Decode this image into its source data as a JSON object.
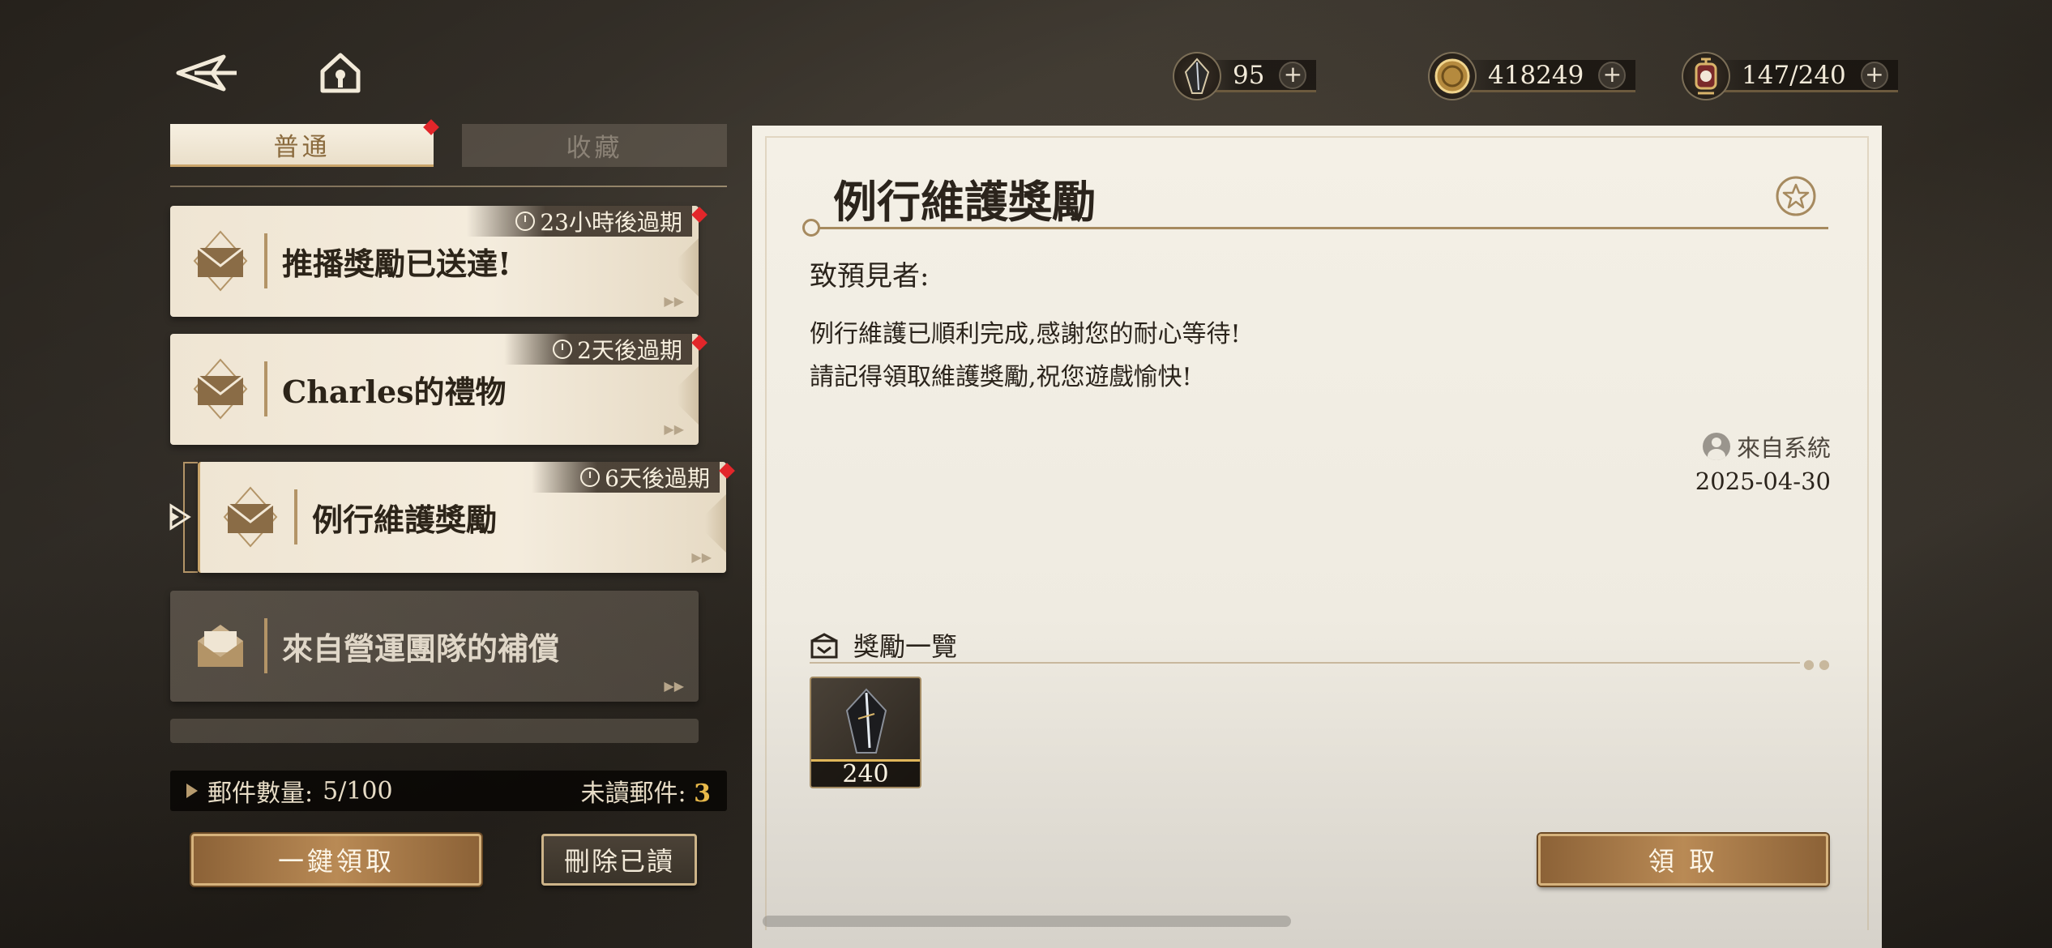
{
  "topbar": {
    "currencies": [
      {
        "icon": "quill-gem-icon",
        "value": "95"
      },
      {
        "icon": "gold-coin-icon",
        "value": "418249"
      },
      {
        "icon": "lantern-icon",
        "value": "147/240"
      }
    ],
    "plus": "+"
  },
  "tabs": {
    "normal": "普通",
    "favorites": "收藏"
  },
  "mails": [
    {
      "title": "推播獎勵已送達!",
      "expire": "23小時後過期",
      "icon": "envelope-icon"
    },
    {
      "title": "Charles的禮物",
      "expire": "2天後過期",
      "icon": "envelope-icon"
    },
    {
      "title": "例行維護獎勵",
      "expire": "6天後過期",
      "icon": "envelope-icon",
      "selected": true
    },
    {
      "title": "來自營運團隊的補償",
      "icon": "open-envelope-icon",
      "read": true
    }
  ],
  "footer": {
    "count_label": "郵件數量:",
    "count_value": "5/100",
    "unread_label": "未讀郵件:",
    "unread_value": "3",
    "claim_all": "一鍵領取",
    "delete_read": "刪除已讀"
  },
  "detail": {
    "title": "例行維護獎勵",
    "greeting": "致預見者:",
    "body": [
      "例行維護已順利完成,感謝您的耐心等待!",
      "請記得領取維護獎勵,祝您遊戲愉快!"
    ],
    "sender": "來自系統",
    "date": "2025-04-30",
    "rewards_label": "獎勵一覽",
    "rewards": [
      {
        "icon": "quill-gem-icon",
        "count": "240"
      }
    ],
    "claim": "領 取"
  },
  "colors": {
    "accent_gold": "#c9a46a",
    "unread_highlight": "#e8b94a",
    "badge_red": "#e2262a"
  }
}
